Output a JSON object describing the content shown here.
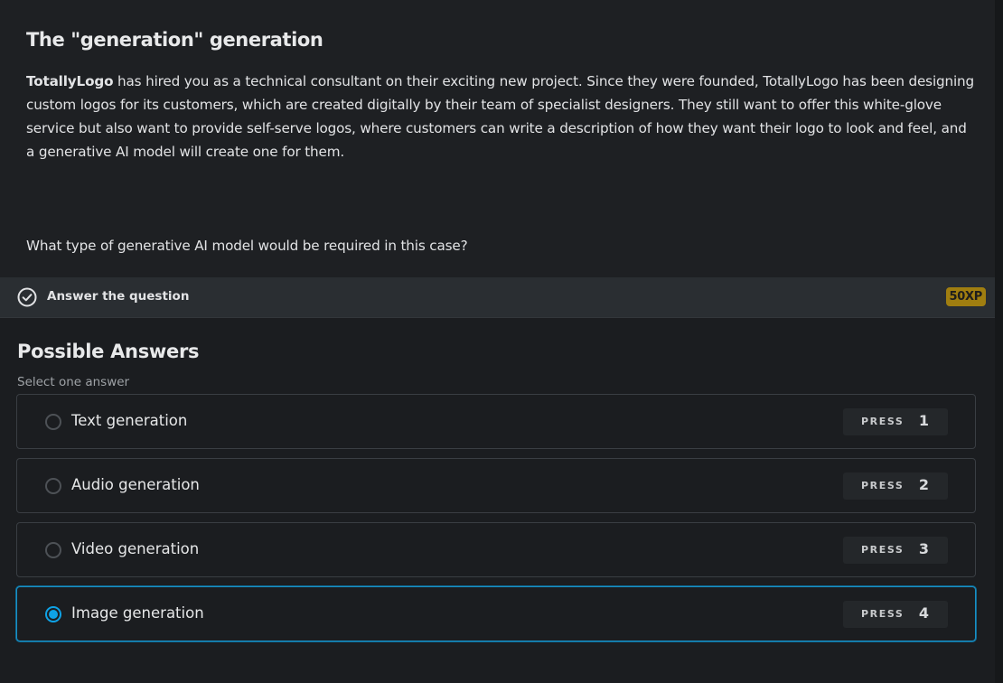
{
  "context": {
    "title": "The \"generation\" generation",
    "company": "TotallyLogo",
    "body_rest": " has hired you as a technical consultant on their exciting new project. Since they were founded, TotallyLogo has been designing custom logos for its customers, which are created digitally by their team of specialist designers. They still want to offer this white-glove service but also want to provide self-serve logos, where customers can write a description of how they want their logo to look and feel, and a generative AI model will create one for them.",
    "question": "What type of generative AI model would be required in this case?"
  },
  "exercise_bar": {
    "icon": "check-circle-icon",
    "label": "Answer the question",
    "xp": "50XP",
    "xp_color": "#a07e10"
  },
  "answers": {
    "heading": "Possible Answers",
    "hint": "Select one answer",
    "press_label": "PRESS",
    "selected_color": "#0ea2e6",
    "options": [
      {
        "label": "Text generation",
        "key": "1",
        "selected": false
      },
      {
        "label": "Audio generation",
        "key": "2",
        "selected": false
      },
      {
        "label": "Video generation",
        "key": "3",
        "selected": false
      },
      {
        "label": "Image generation",
        "key": "4",
        "selected": true
      }
    ]
  }
}
